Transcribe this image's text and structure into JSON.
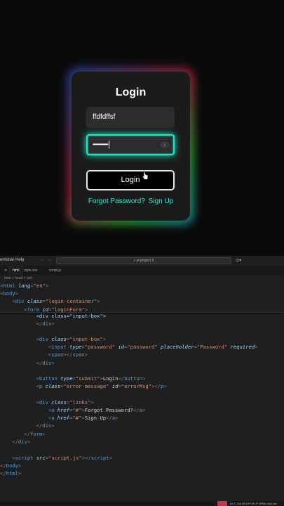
{
  "preview": {
    "title": "Login",
    "username_value": "ffdfdffsf",
    "password_value": "••••••••••••",
    "login_label": "Login",
    "forgot_label": "Forgot Password?",
    "signup_label": "Sign Up"
  },
  "editor": {
    "menu": [
      "erminal",
      "Help"
    ],
    "search_text": "yt project 3",
    "tabs": [
      "html",
      "style.css",
      "script.js"
    ],
    "breadcrumb": "html > head > ook",
    "code_lines": [
      {
        "t": [
          [
            "pu",
            "<"
          ],
          [
            "tg",
            "html "
          ],
          [
            "at",
            "lang"
          ],
          [
            "pu",
            "="
          ],
          [
            "st",
            "\"en\""
          ],
          [
            "pu",
            ">"
          ]
        ],
        "i": 0
      },
      {
        "t": [
          [
            "pu",
            "<"
          ],
          [
            "tg",
            "body"
          ],
          [
            "pu",
            ">"
          ]
        ],
        "i": 0
      },
      {
        "t": [
          [
            "pu",
            "<"
          ],
          [
            "tg",
            "div "
          ],
          [
            "at",
            "class"
          ],
          [
            "pu",
            "="
          ],
          [
            "st",
            "\"login-container\""
          ],
          [
            "pu",
            ">"
          ]
        ],
        "i": 2
      },
      {
        "t": [
          [
            "pu",
            "<"
          ],
          [
            "tg",
            "form "
          ],
          [
            "at",
            "id"
          ],
          [
            "pu",
            "="
          ],
          [
            "st",
            "\"loginForm\""
          ],
          [
            "pu",
            ">"
          ]
        ],
        "i": 4
      },
      {
        "t": [
          [
            "pu",
            "</"
          ],
          [
            "tg",
            "div"
          ],
          [
            "pu",
            ">"
          ]
        ],
        "i": 6
      },
      {
        "t": [],
        "i": 0
      },
      {
        "t": [
          [
            "pu",
            "<"
          ],
          [
            "tg",
            "div "
          ],
          [
            "at",
            "class"
          ],
          [
            "pu",
            "="
          ],
          [
            "st",
            "\"input-box\""
          ],
          [
            "pu",
            ">"
          ]
        ],
        "i": 6
      },
      {
        "t": [
          [
            "pu",
            "<"
          ],
          [
            "tg",
            "input "
          ],
          [
            "at",
            "type"
          ],
          [
            "pu",
            "="
          ],
          [
            "st",
            "\"password\" "
          ],
          [
            "at",
            "id"
          ],
          [
            "pu",
            "="
          ],
          [
            "st",
            "\"password\" "
          ],
          [
            "at",
            "placeholder"
          ],
          [
            "pu",
            "="
          ],
          [
            "st",
            "\"Password\" "
          ],
          [
            "at",
            "required"
          ],
          [
            "pu",
            ">"
          ]
        ],
        "i": 8
      },
      {
        "t": [
          [
            "pu",
            "<"
          ],
          [
            "tg",
            "span"
          ],
          [
            "pu",
            "></"
          ],
          [
            "tg",
            "span"
          ],
          [
            "pu",
            ">"
          ]
        ],
        "i": 8
      },
      {
        "t": [
          [
            "pu",
            "</"
          ],
          [
            "tg",
            "div"
          ],
          [
            "pu",
            ">"
          ]
        ],
        "i": 6
      },
      {
        "t": [],
        "i": 0
      },
      {
        "t": [
          [
            "pu",
            "<"
          ],
          [
            "tg",
            "button "
          ],
          [
            "at",
            "type"
          ],
          [
            "pu",
            "="
          ],
          [
            "st",
            "\"submit\""
          ],
          [
            "pu",
            ">"
          ],
          [
            "tx",
            "Login"
          ],
          [
            "pu",
            "</"
          ],
          [
            "tg",
            "button"
          ],
          [
            "pu",
            ">"
          ]
        ],
        "i": 6
      },
      {
        "t": [
          [
            "pu",
            "<"
          ],
          [
            "tg",
            "p "
          ],
          [
            "at",
            "class"
          ],
          [
            "pu",
            "="
          ],
          [
            "st",
            "\"error-message\" "
          ],
          [
            "at",
            "id"
          ],
          [
            "pu",
            "="
          ],
          [
            "st",
            "\"errorMsg\""
          ],
          [
            "pu",
            "></"
          ],
          [
            "tg",
            "p"
          ],
          [
            "pu",
            ">"
          ]
        ],
        "i": 6
      },
      {
        "t": [],
        "i": 0
      },
      {
        "t": [
          [
            "pu",
            "<"
          ],
          [
            "tg",
            "div "
          ],
          [
            "at",
            "class"
          ],
          [
            "pu",
            "="
          ],
          [
            "st",
            "\"links\""
          ],
          [
            "pu",
            ">"
          ]
        ],
        "i": 6
      },
      {
        "t": [
          [
            "pu",
            "<"
          ],
          [
            "tg",
            "a "
          ],
          [
            "at",
            "href"
          ],
          [
            "pu",
            "="
          ],
          [
            "st",
            "\"#\""
          ],
          [
            "pu",
            ">"
          ],
          [
            "tx",
            "Forgot Password?"
          ],
          [
            "pu",
            "</"
          ],
          [
            "tg",
            "a"
          ],
          [
            "pu",
            ">"
          ]
        ],
        "i": 8
      },
      {
        "t": [
          [
            "pu",
            "<"
          ],
          [
            "tg",
            "a "
          ],
          [
            "at",
            "href"
          ],
          [
            "pu",
            "="
          ],
          [
            "st",
            "\"#\""
          ],
          [
            "pu",
            ">"
          ],
          [
            "tx",
            "Sign Up"
          ],
          [
            "pu",
            "</"
          ],
          [
            "tg",
            "a"
          ],
          [
            "pu",
            ">"
          ]
        ],
        "i": 8
      },
      {
        "t": [
          [
            "pu",
            "</"
          ],
          [
            "tg",
            "div"
          ],
          [
            "pu",
            ">"
          ]
        ],
        "i": 6
      },
      {
        "t": [
          [
            "pu",
            "</"
          ],
          [
            "tg",
            "form"
          ],
          [
            "pu",
            ">"
          ]
        ],
        "i": 4
      },
      {
        "t": [
          [
            "pu",
            "</"
          ],
          [
            "tg",
            "div"
          ],
          [
            "pu",
            ">"
          ]
        ],
        "i": 2
      },
      {
        "t": [],
        "i": 0
      },
      {
        "t": [
          [
            "pu",
            "<"
          ],
          [
            "tg",
            "script "
          ],
          [
            "at",
            "src"
          ],
          [
            "pu",
            "="
          ],
          [
            "st",
            "\"script.js\""
          ],
          [
            "pu",
            "></"
          ],
          [
            "tg",
            "script"
          ],
          [
            "pu",
            ">"
          ]
        ],
        "i": 2
      },
      {
        "t": [
          [
            "pu",
            "</"
          ],
          [
            "tg",
            "body"
          ],
          [
            "pu",
            ">"
          ]
        ],
        "i": 0
      },
      {
        "t": [
          [
            "pu",
            "</"
          ],
          [
            "tg",
            "html"
          ],
          [
            "pu",
            ">"
          ]
        ],
        "i": 0
      }
    ],
    "hidden_partial_line": "div class=\"input-box\">",
    "status_text": "Ln 7, Col 26  UTF-8  LF  HTML  Go Live"
  }
}
